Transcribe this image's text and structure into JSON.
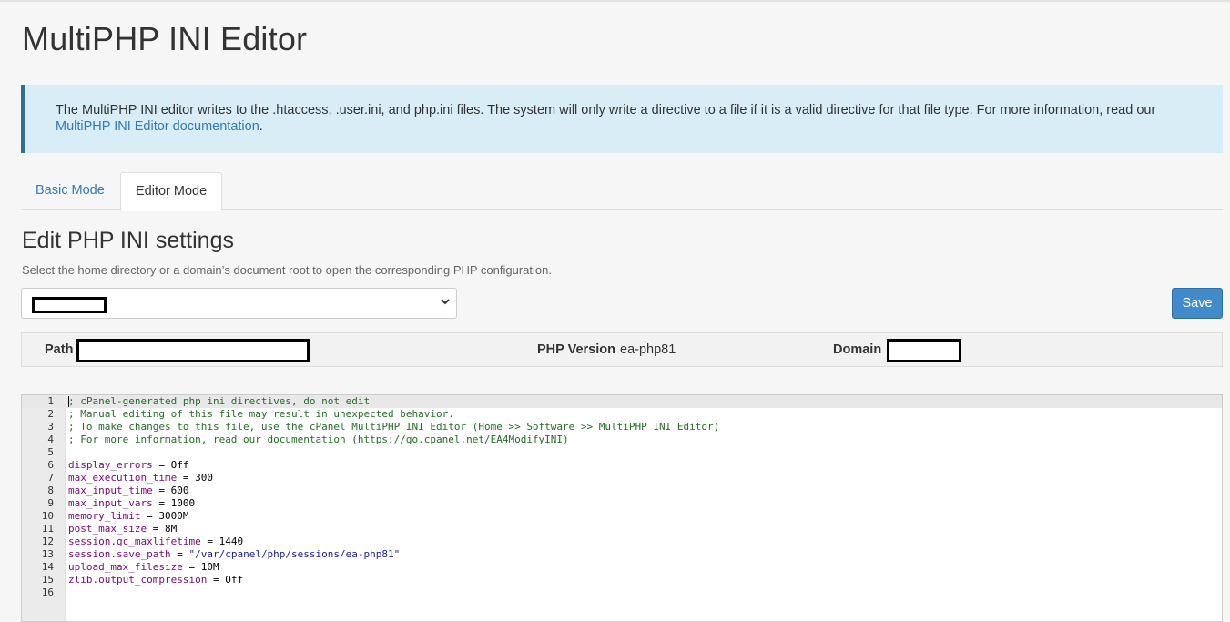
{
  "page": {
    "title": "MultiPHP INI Editor"
  },
  "info": {
    "text": "The MultiPHP INI editor writes to the .htaccess, .user.ini, and php.ini files. The system will only write a directive to a file if it is a valid directive for that file type. For more information, read our",
    "link": "MultiPHP INI Editor documentation",
    "end": "."
  },
  "tabs": {
    "basic": "Basic Mode",
    "editor": "Editor Mode"
  },
  "section": {
    "title": "Edit PHP INI settings",
    "description": "Select the home directory or a domain’s document root to open the corresponding PHP configuration."
  },
  "save_label": "Save",
  "info_bar": {
    "path_label": "Path",
    "php_version_label": "PHP Version",
    "php_version_value": "ea-php81",
    "domain_label": "Domain"
  },
  "editor": {
    "lines": [
      {
        "n": "1",
        "parts": [
          {
            "t": "; cPanel-generated php ini directives, do not edit",
            "c": "comment"
          }
        ]
      },
      {
        "n": "2",
        "parts": [
          {
            "t": "; Manual editing of this file may result in unexpected behavior.",
            "c": "comment"
          }
        ]
      },
      {
        "n": "3",
        "parts": [
          {
            "t": "; To make changes to this file, use the cPanel MultiPHP INI Editor (Home >> Software >> MultiPHP INI Editor)",
            "c": "comment"
          }
        ]
      },
      {
        "n": "4",
        "parts": [
          {
            "t": "; For more information, read our documentation (https://go.cpanel.net/EA4ModifyINI)",
            "c": "comment"
          }
        ]
      },
      {
        "n": "5",
        "parts": []
      },
      {
        "n": "6",
        "parts": [
          {
            "t": "display_errors",
            "c": "key"
          },
          {
            "t": " = Off",
            "c": ""
          }
        ]
      },
      {
        "n": "7",
        "parts": [
          {
            "t": "max_execution_time",
            "c": "key"
          },
          {
            "t": " = 300",
            "c": ""
          }
        ]
      },
      {
        "n": "8",
        "parts": [
          {
            "t": "max_input_time",
            "c": "key"
          },
          {
            "t": " = 600",
            "c": ""
          }
        ]
      },
      {
        "n": "9",
        "parts": [
          {
            "t": "max_input_vars",
            "c": "key"
          },
          {
            "t": " = 1000",
            "c": ""
          }
        ]
      },
      {
        "n": "10",
        "parts": [
          {
            "t": "memory_limit",
            "c": "key"
          },
          {
            "t": " = 3000M",
            "c": ""
          }
        ]
      },
      {
        "n": "11",
        "parts": [
          {
            "t": "post_max_size",
            "c": "key"
          },
          {
            "t": " = 8M",
            "c": ""
          }
        ]
      },
      {
        "n": "12",
        "parts": [
          {
            "t": "session.gc_maxlifetime",
            "c": "key"
          },
          {
            "t": " = 1440",
            "c": ""
          }
        ]
      },
      {
        "n": "13",
        "parts": [
          {
            "t": "session.save_path",
            "c": "key"
          },
          {
            "t": " = ",
            "c": ""
          },
          {
            "t": "\"/var/cpanel/php/sessions/ea-php81\"",
            "c": "str"
          }
        ]
      },
      {
        "n": "14",
        "parts": [
          {
            "t": "upload_max_filesize",
            "c": "key"
          },
          {
            "t": " = 10M",
            "c": ""
          }
        ]
      },
      {
        "n": "15",
        "parts": [
          {
            "t": "zlib.output_compression",
            "c": "key"
          },
          {
            "t": " = Off",
            "c": ""
          }
        ]
      },
      {
        "n": "16",
        "parts": []
      }
    ]
  }
}
